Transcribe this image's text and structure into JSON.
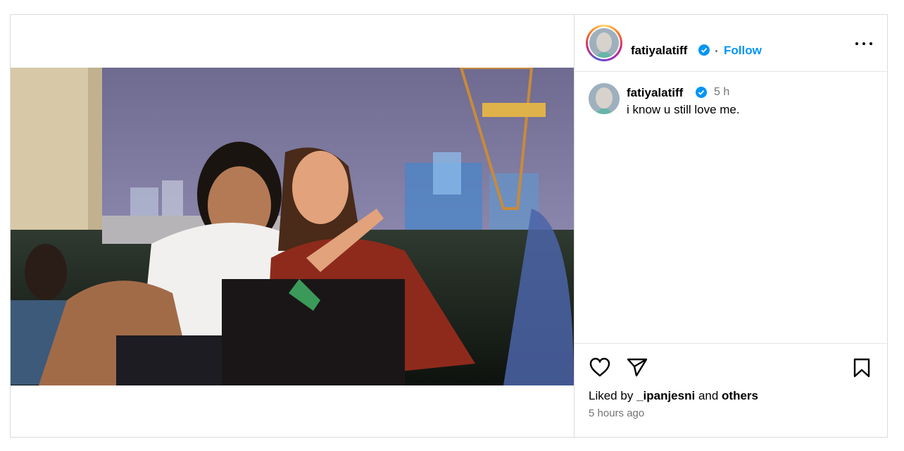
{
  "post": {
    "author": "fatiyalatiff",
    "follow_label": "Follow",
    "caption_author": "fatiyalatiff",
    "caption_time": "5 h",
    "caption_text": "i know u still love me.",
    "liked_by_prefix": "Liked by",
    "liked_by_user": "_ipanjesni",
    "liked_by_and": "and",
    "liked_by_others": "others",
    "posted_ago": "5 hours ago"
  },
  "icons": [
    "verified-badge-icon",
    "more-options-icon",
    "heart-icon",
    "share-icon",
    "bookmark-icon"
  ],
  "colors": {
    "accent": "#0095f6",
    "muted": "#737373",
    "border": "#dbdbdb"
  }
}
